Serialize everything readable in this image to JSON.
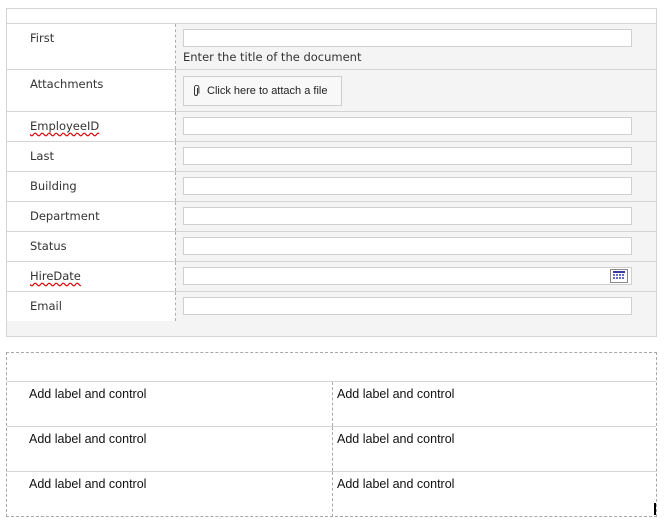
{
  "form": {
    "rows": [
      {
        "key": "first",
        "label": "First",
        "hint": "Enter the title of the document"
      },
      {
        "key": "attachments",
        "label": "Attachments",
        "attach_text": "Click here to attach a file"
      },
      {
        "key": "employeeid",
        "label": "EmployeeID",
        "spellcheck": true
      },
      {
        "key": "last",
        "label": "Last"
      },
      {
        "key": "building",
        "label": "Building"
      },
      {
        "key": "department",
        "label": "Department"
      },
      {
        "key": "status",
        "label": "Status"
      },
      {
        "key": "hiredate",
        "label": "HireDate",
        "spellcheck": true,
        "icon": "calendar-icon"
      },
      {
        "key": "email",
        "label": "Email"
      }
    ]
  },
  "layout_table": {
    "cells": [
      [
        "Add label and control",
        "Add label and control"
      ],
      [
        "Add label and control",
        "Add label and control"
      ],
      [
        "Add label and control",
        "Add label and control"
      ]
    ]
  }
}
